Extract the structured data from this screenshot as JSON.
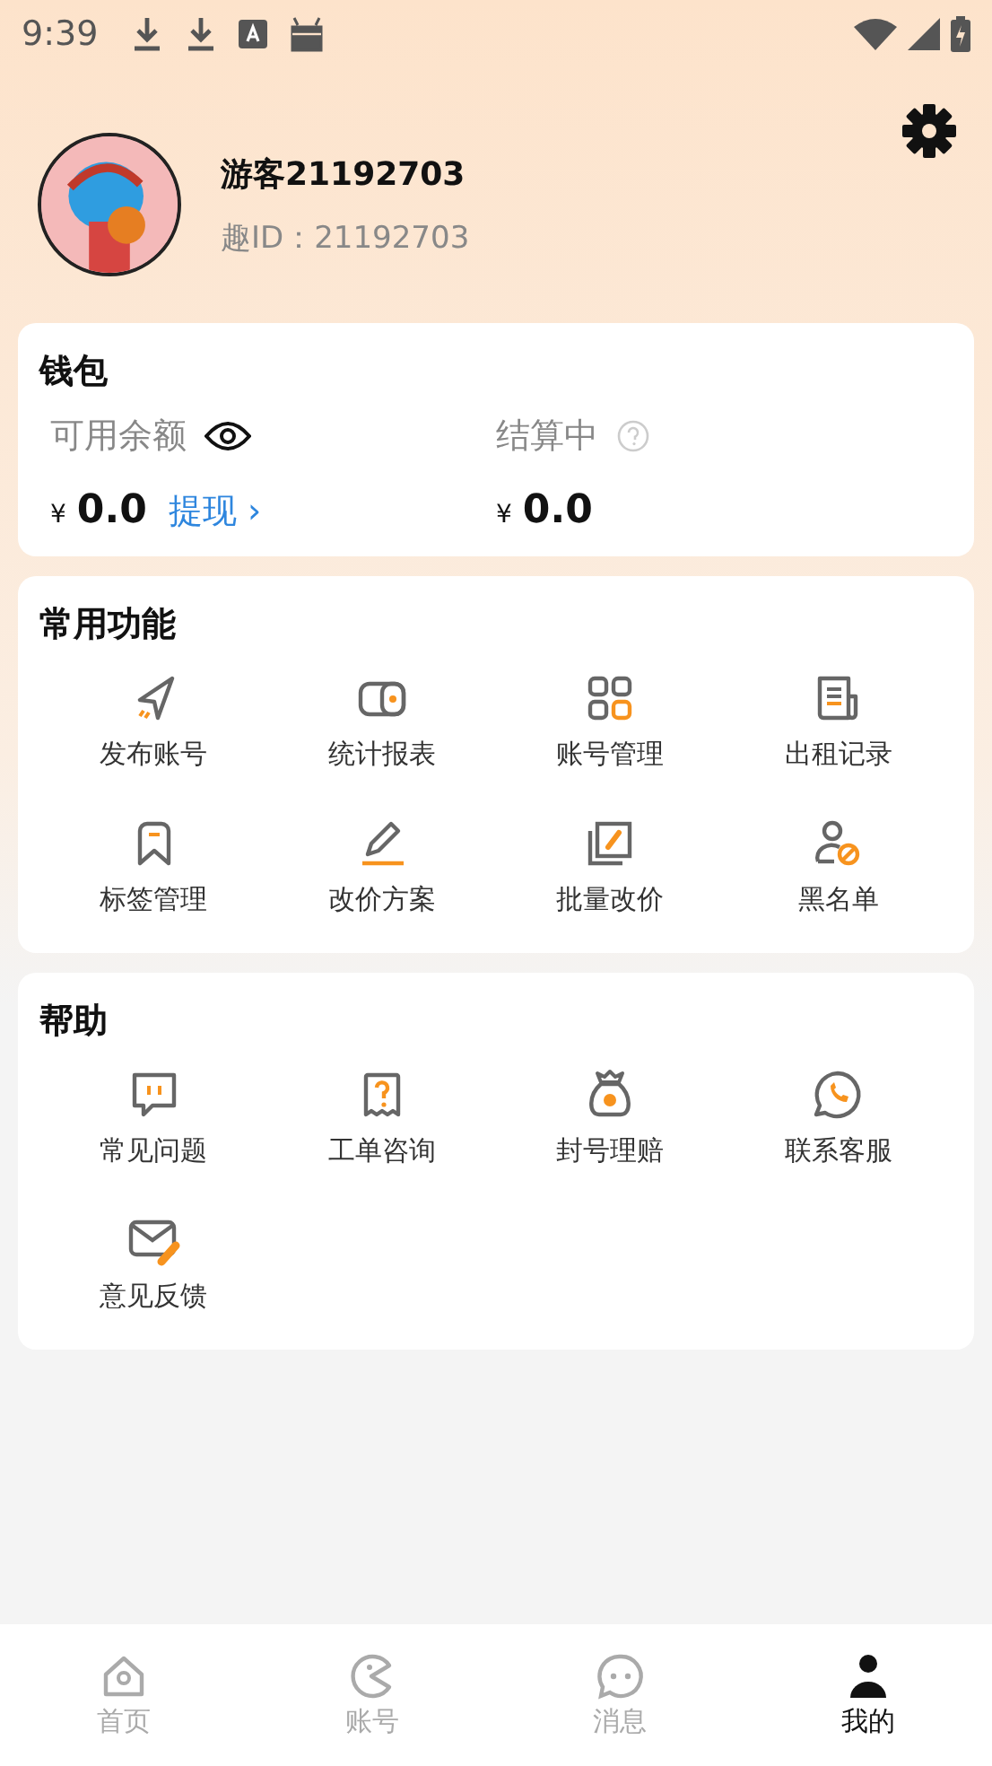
{
  "status_bar": {
    "time": "9:39"
  },
  "profile": {
    "name": "游客21192703",
    "id_label": "趣ID：21192703"
  },
  "wallet": {
    "title": "钱包",
    "available": {
      "label": "可用余额",
      "currency": "¥",
      "amount": "0.0",
      "action": "提现 ›"
    },
    "settling": {
      "label": "结算中",
      "currency": "¥",
      "amount": "0.0"
    }
  },
  "functions": {
    "title": "常用功能",
    "items": [
      {
        "label": "发布账号"
      },
      {
        "label": "统计报表"
      },
      {
        "label": "账号管理"
      },
      {
        "label": "出租记录"
      },
      {
        "label": "标签管理"
      },
      {
        "label": "改价方案"
      },
      {
        "label": "批量改价"
      },
      {
        "label": "黑名单"
      }
    ]
  },
  "help": {
    "title": "帮助",
    "items": [
      {
        "label": "常见问题"
      },
      {
        "label": "工单咨询"
      },
      {
        "label": "封号理赔"
      },
      {
        "label": "联系客服"
      },
      {
        "label": "意见反馈"
      }
    ]
  },
  "tab_bar": [
    {
      "label": "首页",
      "selected": false
    },
    {
      "label": "账号",
      "selected": false
    },
    {
      "label": "消息",
      "selected": false
    },
    {
      "label": "我的",
      "selected": true
    }
  ]
}
